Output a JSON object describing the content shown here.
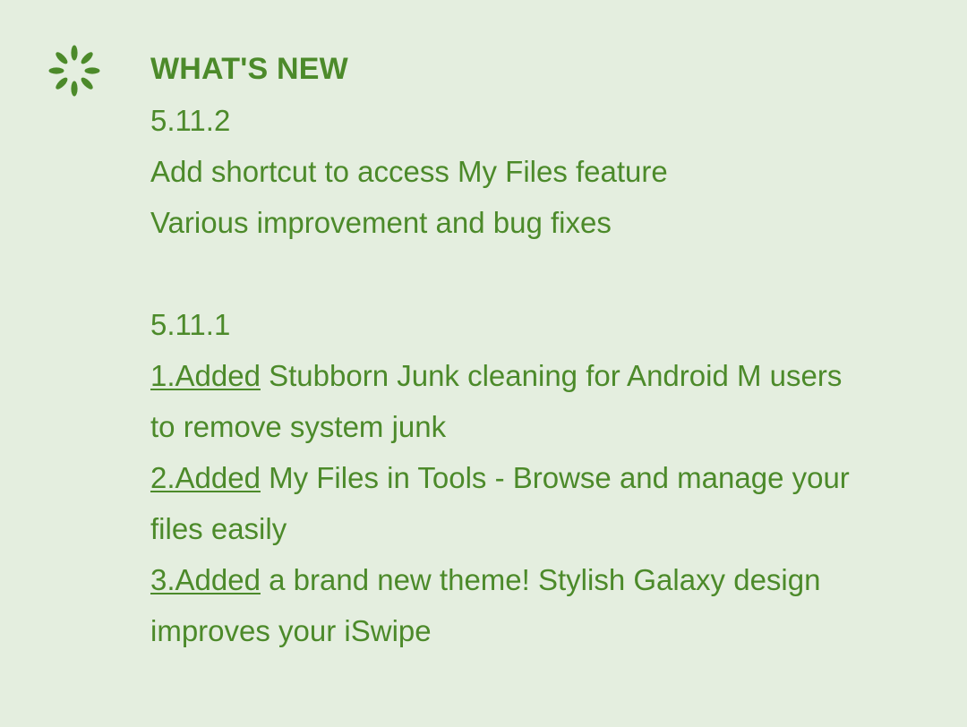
{
  "whats_new": {
    "icon": "sparkle-icon",
    "title": "WHAT'S NEW",
    "releases": [
      {
        "version": "5.11.2",
        "lines": [
          "Add shortcut to access My Files feature",
          "Various improvement and bug fixes"
        ]
      },
      {
        "version": "5.11.1",
        "items": [
          {
            "link": "1.Added",
            "text": " Stubborn Junk cleaning for Android M users",
            "continuation": "to remove system junk"
          },
          {
            "link": "2.Added",
            "text": " My Files in Tools - Browse and manage your",
            "continuation": "files easily"
          },
          {
            "link": "3.Added",
            "text": " a brand new theme! Stylish Galaxy design",
            "continuation": "improves your iSwipe"
          }
        ]
      }
    ]
  },
  "colors": {
    "background": "#e4eedf",
    "text": "#4c8a2a"
  }
}
